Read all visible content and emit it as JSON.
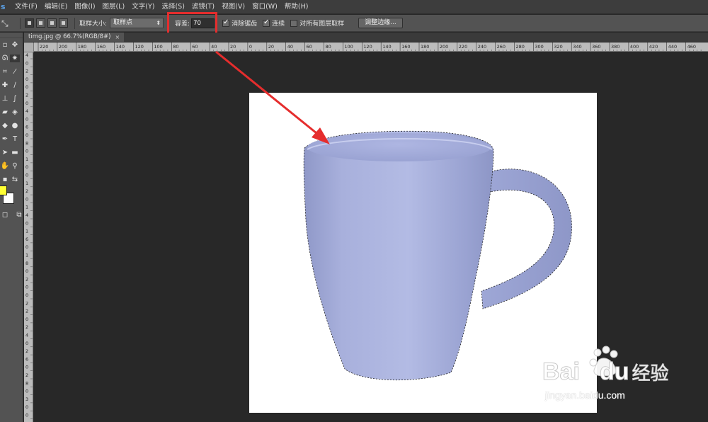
{
  "app": {
    "logo": "s"
  },
  "menu": [
    "文件(F)",
    "编辑(E)",
    "图像(I)",
    "图层(L)",
    "文字(Y)",
    "选择(S)",
    "滤镜(T)",
    "视图(V)",
    "窗口(W)",
    "帮助(H)"
  ],
  "options": {
    "tool_glyph": "⤡",
    "sample_size_label": "取样大小:",
    "sample_size_value": "取样点",
    "tolerance_label": "容差:",
    "tolerance_value": "70",
    "anti_alias_label": "消除锯齿",
    "contiguous_label": "连续",
    "all_layers_label": "对所有图层取样",
    "refine_edge_label": "调整边缘..."
  },
  "document": {
    "tab_title": "timg.jpg @ 66.7%(RGB/8#)",
    "close_glyph": "×"
  },
  "ruler": {
    "h_labels": [
      "220",
      "200",
      "180",
      "160",
      "140",
      "120",
      "100",
      "80",
      "60",
      "40",
      "20",
      "0",
      "20",
      "40",
      "60",
      "80",
      "100",
      "120",
      "140",
      "160",
      "180",
      "200",
      "220",
      "240",
      "260",
      "280",
      "300",
      "320",
      "340",
      "360",
      "380",
      "400",
      "420",
      "440",
      "460"
    ],
    "v_labels": [
      "4",
      "0",
      "2",
      "0",
      "0",
      "2",
      "0",
      "4",
      "0",
      "6",
      "0",
      "8",
      "0",
      "1",
      "0",
      "0",
      "1",
      "2",
      "0",
      "1",
      "4",
      "0",
      "1",
      "6",
      "0",
      "1",
      "8",
      "0",
      "2",
      "0",
      "0",
      "2",
      "2",
      "0",
      "2",
      "4",
      "0",
      "2",
      "6",
      "0",
      "2",
      "8",
      "0",
      "3",
      "0",
      "0"
    ]
  },
  "colors": {
    "foreground": "#ffff33",
    "background": "#ffffff",
    "highlight": "#e52d2d",
    "mug": "#a4acd8"
  },
  "watermark": {
    "brand": "Bai",
    "brand2": "du",
    "cn": "经验",
    "url": "jingyan.baidu.com"
  }
}
